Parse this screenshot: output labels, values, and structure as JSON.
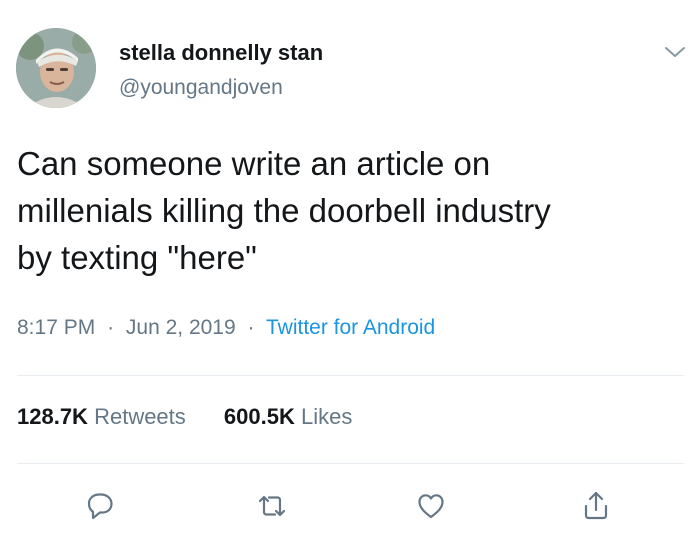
{
  "author": {
    "display_name": "stella donnelly stan",
    "handle": "@youngandjoven",
    "avatar_icon": "user-photo"
  },
  "tweet": {
    "text_lines": [
      "Can someone write an article on",
      "millenials killing the doorbell industry",
      "by texting \"here\""
    ]
  },
  "meta": {
    "time": "8:17 PM",
    "separator": "·",
    "date": "Jun 2, 2019",
    "source": "Twitter for Android"
  },
  "stats": {
    "retweets_count": "128.7K",
    "retweets_label": "Retweets",
    "likes_count": "600.5K",
    "likes_label": "Likes"
  },
  "actions": {
    "icons": [
      "reply-icon",
      "retweet-icon",
      "like-icon",
      "share-icon"
    ],
    "icon_color": "#657786"
  },
  "colors": {
    "text": "#14171a",
    "secondary": "#657786",
    "link": "#1b95e0",
    "divider": "#e6ecf0"
  }
}
